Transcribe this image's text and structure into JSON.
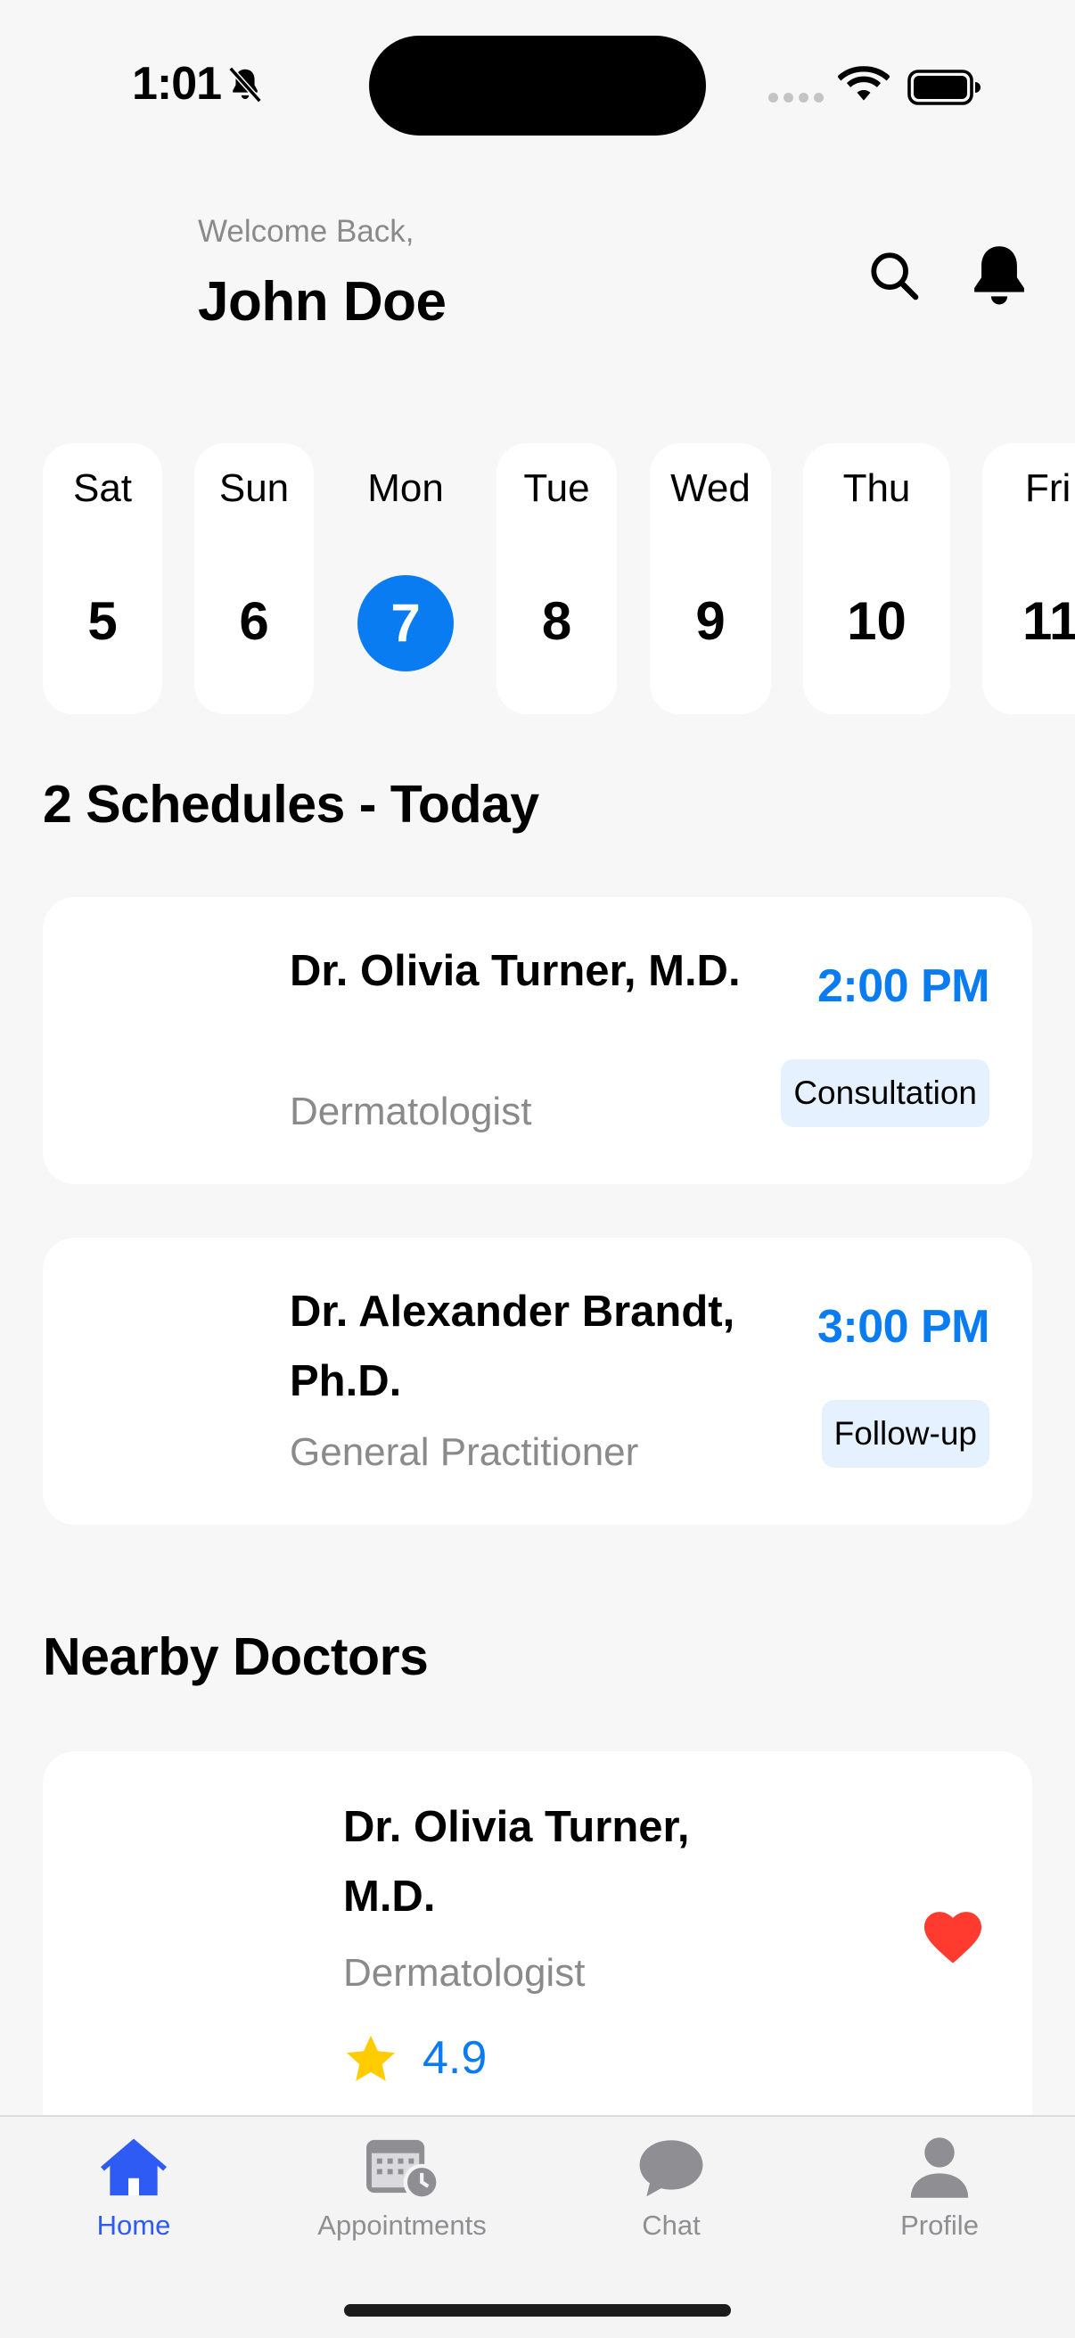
{
  "status_bar": {
    "time": "1:01"
  },
  "header": {
    "welcome": "Welcome Back,",
    "user_name": "John Doe"
  },
  "dates": [
    {
      "day": "Sat",
      "num": "5"
    },
    {
      "day": "Sun",
      "num": "6"
    },
    {
      "day": "Mon",
      "num": "7",
      "selected": true
    },
    {
      "day": "Tue",
      "num": "8"
    },
    {
      "day": "Wed",
      "num": "9"
    },
    {
      "day": "Thu",
      "num": "10"
    },
    {
      "day": "Fri",
      "num": "11"
    }
  ],
  "schedules": {
    "title": "2 Schedules - Today",
    "items": [
      {
        "name": "Dr. Olivia Turner, M.D.",
        "specialty": "Dermatologist",
        "time": "2:00 PM",
        "type": "Consultation"
      },
      {
        "name": "Dr. Alexander Brandt, Ph.D.",
        "specialty": "General Practitioner",
        "time": "3:00 PM",
        "type": "Follow-up"
      }
    ]
  },
  "nearby": {
    "title": "Nearby Doctors",
    "items": [
      {
        "name": "Dr. Olivia Turner, M.D.",
        "specialty": "Dermatologist",
        "rating": "4.9",
        "favorite": true
      }
    ]
  },
  "tabs": [
    {
      "label": "Home",
      "icon": "home-icon",
      "active": true
    },
    {
      "label": "Appointments",
      "icon": "calendar-clock-icon"
    },
    {
      "label": "Chat",
      "icon": "chat-bubble-icon"
    },
    {
      "label": "Profile",
      "icon": "person-icon"
    }
  ],
  "colors": {
    "accent": "#0a7cf2",
    "tab_active": "#2f5bf5",
    "badge_bg": "#e5f1ff",
    "heart": "#ff3b30",
    "star": "#ffcc00"
  }
}
